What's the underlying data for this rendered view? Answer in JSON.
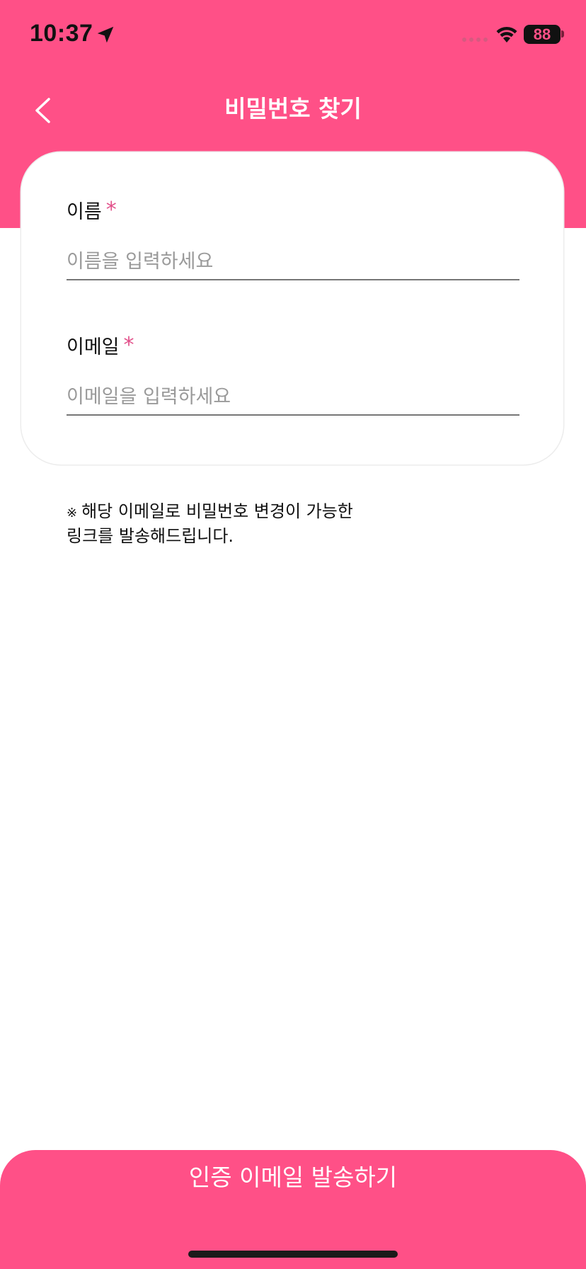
{
  "status_bar": {
    "time": "10:37",
    "battery": "88"
  },
  "header": {
    "title": "비밀번호 찾기"
  },
  "form": {
    "name_label": "이름",
    "name_required": "*",
    "name_placeholder": "이름을 입력하세요",
    "email_label": "이메일",
    "email_required": "*",
    "email_placeholder": "이메일을 입력하세요"
  },
  "notice": {
    "mark": "※",
    "line1": "해당 이메일로 비밀번호 변경이 가능한",
    "line2": "링크를 발송해드립니다."
  },
  "submit": {
    "label": "인증 이메일 발송하기"
  },
  "colors": {
    "brand": "#ff5087",
    "required": "#e2508a"
  }
}
